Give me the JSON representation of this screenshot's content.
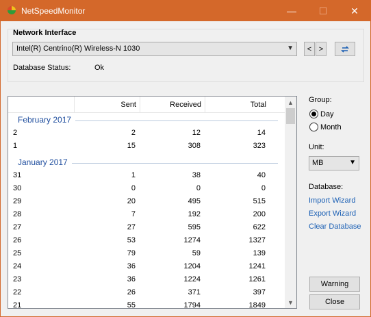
{
  "window": {
    "title": "NetSpeedMonitor",
    "controls": {
      "minimize": "—",
      "maximize": "☐",
      "close": "✕"
    }
  },
  "network": {
    "group_title": "Network Interface",
    "interface": "Intel(R) Centrino(R) Wireless-N 1030",
    "prev": "<",
    "next": ">",
    "db_status_label": "Database Status:",
    "db_status_value": "Ok"
  },
  "table": {
    "headers": {
      "sent": "Sent",
      "received": "Received",
      "total": "Total"
    },
    "groups": [
      {
        "label": "February 2017",
        "rows": [
          {
            "day": "2",
            "sent": "2",
            "received": "12",
            "total": "14"
          },
          {
            "day": "1",
            "sent": "15",
            "received": "308",
            "total": "323"
          }
        ]
      },
      {
        "label": "January 2017",
        "rows": [
          {
            "day": "31",
            "sent": "1",
            "received": "38",
            "total": "40"
          },
          {
            "day": "30",
            "sent": "0",
            "received": "0",
            "total": "0"
          },
          {
            "day": "29",
            "sent": "20",
            "received": "495",
            "total": "515"
          },
          {
            "day": "28",
            "sent": "7",
            "received": "192",
            "total": "200"
          },
          {
            "day": "27",
            "sent": "27",
            "received": "595",
            "total": "622"
          },
          {
            "day": "26",
            "sent": "53",
            "received": "1274",
            "total": "1327"
          },
          {
            "day": "25",
            "sent": "79",
            "received": "59",
            "total": "139"
          },
          {
            "day": "24",
            "sent": "36",
            "received": "1204",
            "total": "1241"
          },
          {
            "day": "23",
            "sent": "36",
            "received": "1224",
            "total": "1261"
          },
          {
            "day": "22",
            "sent": "26",
            "received": "371",
            "total": "397"
          },
          {
            "day": "21",
            "sent": "55",
            "received": "1794",
            "total": "1849"
          }
        ]
      }
    ]
  },
  "side": {
    "group_label": "Group:",
    "group_options": [
      "Day",
      "Month"
    ],
    "group_selected": "Day",
    "unit_label": "Unit:",
    "unit_value": "MB",
    "database_label": "Database:",
    "links": [
      "Import Wizard",
      "Export Wizard",
      "Clear Database"
    ],
    "warning_button": "Warning",
    "close_button": "Close"
  },
  "colors": {
    "titlebar": "#d4682a",
    "link": "#1a5fb4",
    "group_header": "#1f4e9e"
  }
}
